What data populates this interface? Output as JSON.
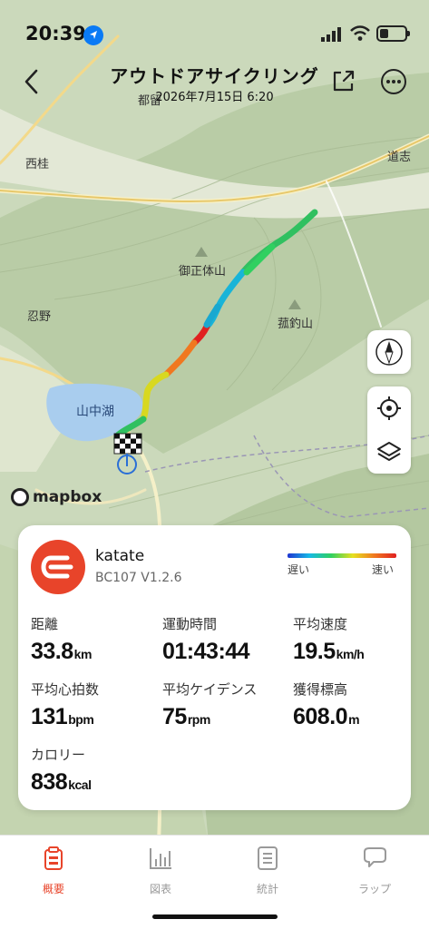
{
  "status": {
    "time": "20:39"
  },
  "header": {
    "title": "アウトドアサイクリング",
    "subtitle": "2026年7月15日 6:20"
  },
  "map": {
    "labels": [
      "都留",
      "道志",
      "西桂",
      "御正体山",
      "忍野",
      "菰釣山"
    ],
    "lake": "山中湖",
    "attribution": "mapbox"
  },
  "card": {
    "user": "katate",
    "device": "BC107  V1.2.6",
    "legend": {
      "slow": "遅い",
      "fast": "速い",
      "colors": [
        "#1f35d1",
        "#16b9e6",
        "#30d060",
        "#e6e020",
        "#f07820",
        "#e02020"
      ]
    },
    "stats": [
      {
        "label": "距離",
        "value": "33.8",
        "unit": "km"
      },
      {
        "label": "運動時間",
        "value": "01:43:44",
        "unit": ""
      },
      {
        "label": "平均速度",
        "value": "19.5",
        "unit": "km/h"
      },
      {
        "label": "平均心拍数",
        "value": "131",
        "unit": "bpm"
      },
      {
        "label": "平均ケイデンス",
        "value": "75",
        "unit": "rpm"
      },
      {
        "label": "獲得標高",
        "value": "608.0",
        "unit": "m"
      },
      {
        "label": "カロリー",
        "value": "838",
        "unit": "kcal"
      }
    ]
  },
  "tabs": [
    {
      "label": "概要",
      "icon": "clipboard-icon",
      "active": true
    },
    {
      "label": "図表",
      "icon": "chart-icon",
      "active": false
    },
    {
      "label": "統計",
      "icon": "list-icon",
      "active": false
    },
    {
      "label": "ラップ",
      "icon": "chat-icon",
      "active": false
    }
  ],
  "colors": {
    "accent": "#e8442a"
  }
}
